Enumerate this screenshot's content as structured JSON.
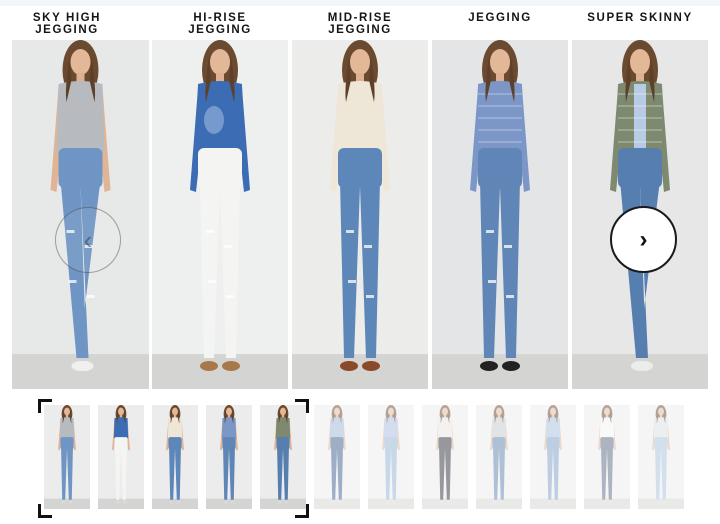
{
  "labels": [
    {
      "lines": [
        "SKY HIGH",
        "JEGGING"
      ]
    },
    {
      "lines": [
        "HI-RISE",
        "JEGGING"
      ]
    },
    {
      "lines": [
        "MID-RISE",
        "JEGGING"
      ]
    },
    {
      "lines": [
        "JEGGING",
        ""
      ]
    },
    {
      "lines": [
        "SUPER SKINNY",
        ""
      ]
    }
  ],
  "navigation": {
    "prev_icon": "chevron-left-icon",
    "prev_glyph": "‹",
    "next_icon": "chevron-right-icon",
    "next_glyph": "›"
  },
  "panels": [
    {
      "bg": "#e7e8e8",
      "top_color": "#b7bbbf",
      "top_style": "tee",
      "jeans": "#6f95c4",
      "shoes": "#f0f0ee",
      "distressed": true,
      "pose": "crossed"
    },
    {
      "bg": "#eef0f0",
      "top_color": "#3b6cb4",
      "top_style": "tiedye",
      "jeans": "#f4f4f2",
      "shoes": "#a8784a",
      "distressed": true,
      "pose": "straight"
    },
    {
      "bg": "#ececea",
      "top_color": "#eee6d6",
      "top_style": "sweater",
      "jeans": "#5d87b9",
      "shoes": "#8a4a2a",
      "distressed": true,
      "pose": "straight"
    },
    {
      "bg": "#e3e5e7",
      "top_color": "#7c96c8",
      "top_style": "plaid",
      "jeans": "#5f86b6",
      "shoes": "#222222",
      "distressed": true,
      "pose": "straight"
    },
    {
      "bg": "#e6e7e6",
      "top_color": "#7e8a70",
      "top_style": "jacket",
      "jeans": "#567fb0",
      "shoes": "#ececea",
      "distressed": false,
      "pose": "crossed"
    }
  ],
  "thumbnails": [
    {
      "top_color": "#b7bbbf",
      "jeans": "#6f95c4",
      "selected": true
    },
    {
      "top_color": "#3b6cb4",
      "jeans": "#f4f4f2",
      "selected": true
    },
    {
      "top_color": "#eee6d6",
      "jeans": "#5d87b9",
      "selected": true
    },
    {
      "top_color": "#7c96c8",
      "jeans": "#5f86b6",
      "selected": true
    },
    {
      "top_color": "#7e8a70",
      "jeans": "#567fb0",
      "selected": true
    },
    {
      "top_color": "#9fb4d6",
      "jeans": "#3f5f8e",
      "selected": false
    },
    {
      "top_color": "#a9bde0",
      "jeans": "#90b2d4",
      "selected": false
    },
    {
      "top_color": "#e9e6e2",
      "jeans": "#2f3440",
      "selected": false
    },
    {
      "top_color": "#c5c8cc",
      "jeans": "#5f82ad",
      "selected": false
    },
    {
      "top_color": "#a9c0de",
      "jeans": "#7e9fc6",
      "selected": false
    },
    {
      "top_color": "#f4f4f4",
      "jeans": "#5c6c86",
      "selected": false
    },
    {
      "top_color": "#dddee0",
      "jeans": "#a6c2de",
      "selected": false
    }
  ]
}
